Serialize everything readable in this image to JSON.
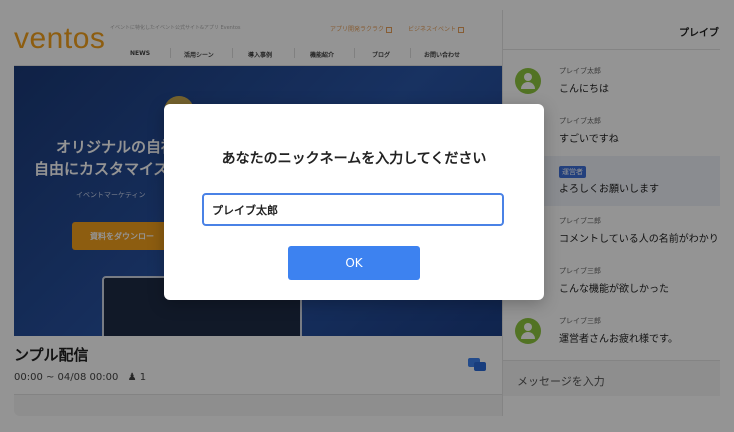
{
  "site": {
    "logo": "ventos",
    "tagline": "イベントに特化したイベント公式サイト&アプリ Eventos",
    "links": [
      {
        "label": "アプリ開発ラクラク"
      },
      {
        "label": "ビジネスイベント"
      }
    ],
    "nav": [
      "NEWS",
      "活用シーン",
      "導入事例",
      "機能紹介",
      "ブログ",
      "お問い合わせ"
    ]
  },
  "hero": {
    "title": "オリジナルの自社",
    "subtitle": "自由にカスタマイズ",
    "caption": "イベントマーケティン",
    "button": "資料をダウンロー"
  },
  "event": {
    "title": "ンプル配信",
    "period": "00:00 ~ 04/08 00:00",
    "viewers": "1"
  },
  "chat": {
    "header": "プレイブ",
    "messages": [
      {
        "sender": "プレイブ太郎",
        "text": "こんにちは",
        "avatar": true,
        "highlight": false,
        "badge": false
      },
      {
        "sender": "プレイブ太郎",
        "text": "すごいですね",
        "avatar": false,
        "highlight": false,
        "badge": false
      },
      {
        "sender": "運営者",
        "text": "よろしくお願いします",
        "avatar": false,
        "highlight": true,
        "badge": true
      },
      {
        "sender": "プレイブ二郎",
        "text": "コメントしている人の名前がわかり",
        "avatar": false,
        "highlight": false,
        "badge": false
      },
      {
        "sender": "プレイブ三郎",
        "text": "こんな機能が欲しかった",
        "avatar": false,
        "highlight": false,
        "badge": false
      },
      {
        "sender": "プレイブ三郎",
        "text": "運営者さんお疲れ様です。",
        "avatar": true,
        "highlight": false,
        "badge": false
      }
    ],
    "input_placeholder": "メッセージを入力"
  },
  "dialog": {
    "title": "あなたのニックネームを入力してください",
    "input_value": "プレイブ太郎",
    "ok_label": "OK"
  },
  "colors": {
    "brand": "#f3a01c",
    "primary": "#3d82f0",
    "avatar": "#8dc63f",
    "staff_badge": "#3d6fd8"
  }
}
